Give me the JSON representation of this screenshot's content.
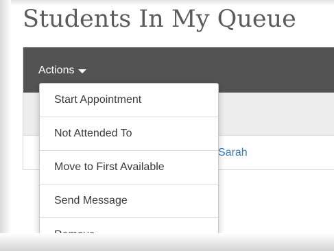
{
  "page": {
    "title": "Students In My Queue"
  },
  "toolbar": {
    "actions_label": "Actions",
    "actions_icon": "caret-down-icon"
  },
  "actions_menu": {
    "items": [
      {
        "label": "Start Appointment"
      },
      {
        "label": "Not Attended To"
      },
      {
        "label": "Move to First Available"
      },
      {
        "label": "Send Message"
      },
      {
        "label": "Remove"
      }
    ]
  },
  "queue_table": {
    "rows": [
      {
        "student_name_partial": "Sarah"
      }
    ]
  },
  "colors": {
    "toolbar_bg": "#535353",
    "header_row_bg": "#ededed",
    "link": "#2f7bbf",
    "title_text": "#5b5b5b"
  }
}
